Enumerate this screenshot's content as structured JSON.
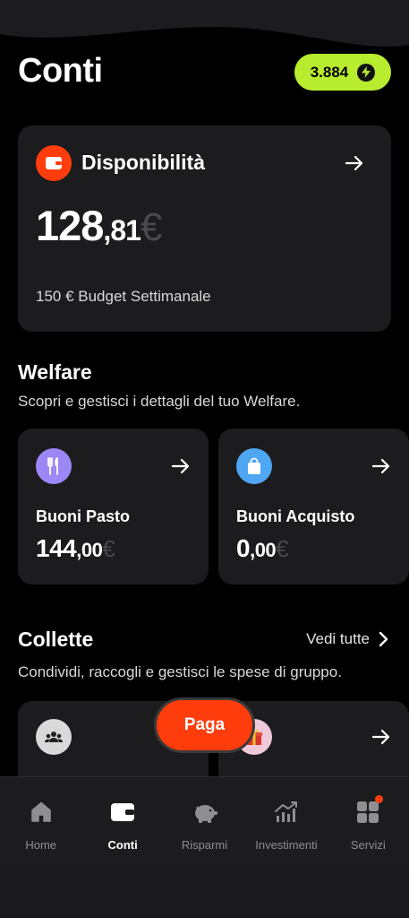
{
  "header": {
    "title": "Conti",
    "points": "3.884"
  },
  "balance_card": {
    "title": "Disponibilità",
    "amount_int": "128",
    "amount_dec": ",81",
    "currency": "€",
    "budget": "150 € Budget Settimanale"
  },
  "welfare": {
    "title": "Welfare",
    "subtitle": "Scopri e gestisci i dettagli del tuo Welfare.",
    "cards": [
      {
        "name": "Buoni Pasto",
        "amount_int": "144",
        "amount_dec": ",00",
        "currency": "€",
        "icon": "fork-knife-icon",
        "color": "#9b87f5"
      },
      {
        "name": "Buoni Acquisto",
        "amount_int": "0",
        "amount_dec": ",00",
        "currency": "€",
        "icon": "shopping-bag-icon",
        "color": "#4fa6f2"
      }
    ]
  },
  "collette": {
    "title": "Collette",
    "see_all": "Vedi tutte",
    "subtitle": "Condividi, raccogli e gestisci le spese di gruppo."
  },
  "pay_button": "Paga",
  "tabs": [
    {
      "label": "Home",
      "icon": "home-icon",
      "active": false
    },
    {
      "label": "Conti",
      "icon": "wallet-icon",
      "active": true
    },
    {
      "label": "Risparmi",
      "icon": "piggy-bank-icon",
      "active": false
    },
    {
      "label": "Investimenti",
      "icon": "chart-icon",
      "active": false
    },
    {
      "label": "Servizi",
      "icon": "grid-icon",
      "active": false,
      "notification": true
    }
  ],
  "colors": {
    "accent": "#ff3d0c",
    "points_badge": "#b8ec2e",
    "card_bg": "#1c1c1e"
  }
}
